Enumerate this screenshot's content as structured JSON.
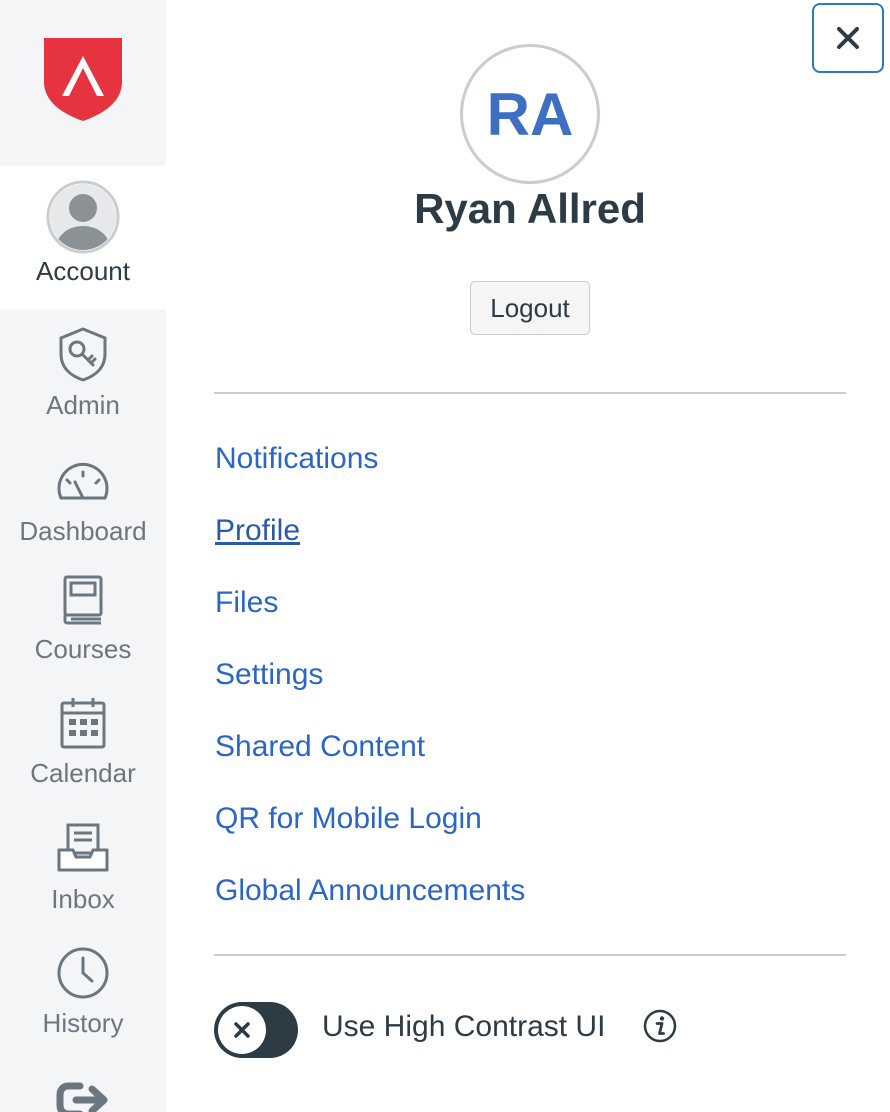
{
  "sidebar": {
    "logo": "instructure-shield-logo",
    "brand_color": "#e5333f",
    "items": [
      {
        "label": "Account",
        "icon": "avatar-icon",
        "active": true
      },
      {
        "label": "Admin",
        "icon": "shield-key-icon"
      },
      {
        "label": "Dashboard",
        "icon": "speedometer-icon"
      },
      {
        "label": "Courses",
        "icon": "book-icon"
      },
      {
        "label": "Calendar",
        "icon": "calendar-icon"
      },
      {
        "label": "Inbox",
        "icon": "inbox-icon"
      },
      {
        "label": "History",
        "icon": "clock-icon"
      },
      {
        "label": "",
        "icon": "logout-arrow-icon"
      }
    ]
  },
  "panel": {
    "close_icon": "close-icon",
    "avatar_initials": "RA",
    "user_name": "Ryan Allred",
    "logout_label": "Logout",
    "links": [
      "Notifications",
      "Profile",
      "Files",
      "Settings",
      "Shared Content",
      "QR for Mobile Login",
      "Global Announcements"
    ],
    "active_link": "Profile",
    "high_contrast": {
      "label": "Use High Contrast UI",
      "enabled": false,
      "info_icon": "info-icon"
    },
    "colors": {
      "link": "#2b66c6",
      "text": "#2d3b45",
      "focus_ring": "#2b7abc"
    }
  }
}
